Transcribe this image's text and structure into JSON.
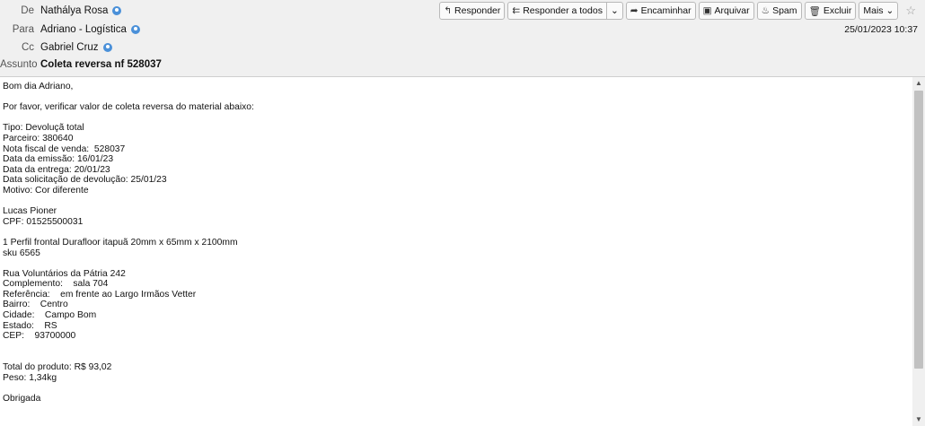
{
  "header": {
    "from_label": "De",
    "from_value": "Nathálya Rosa",
    "to_label": "Para",
    "to_value": "Adriano - Logística",
    "cc_label": "Cc",
    "cc_value": "Gabriel Cruz",
    "subject_label": "Assunto",
    "subject_value": "Coleta reversa nf 528037",
    "date": "25/01/2023 10:37"
  },
  "toolbar": {
    "reply": "Responder",
    "reply_all": "Responder a todos",
    "forward": "Encaminhar",
    "archive": "Arquivar",
    "spam": "Spam",
    "delete": "Excluir",
    "more": "Mais"
  },
  "body_lines": [
    "Bom dia Adriano,",
    "",
    "Por favor, verificar valor de coleta reversa do material abaixo:",
    "",
    "Tipo: Devoluçã total",
    "Parceiro: 380640",
    "Nota fiscal de venda:  528037",
    "Data da emissão: 16/01/23",
    "Data da entrega: 20/01/23",
    "Data solicitação de devolução: 25/01/23",
    "Motivo: Cor diferente",
    "",
    "Lucas Pioner",
    "CPF: 01525500031",
    "",
    "1 Perfil frontal Durafloor itapuã 20mm x 65mm x 2100mm",
    "sku 6565",
    "",
    "Rua Voluntários da Pátria 242",
    "Complemento:    sala 704",
    "Referência:    em frente ao Largo Irmãos Vetter",
    "Bairro:    Centro",
    "Cidade:    Campo Bom",
    "Estado:    RS",
    "CEP:    93700000",
    "",
    "",
    "Total do produto: R$ 93,02",
    "Peso: 1,34kg",
    "",
    "Obrigada"
  ]
}
